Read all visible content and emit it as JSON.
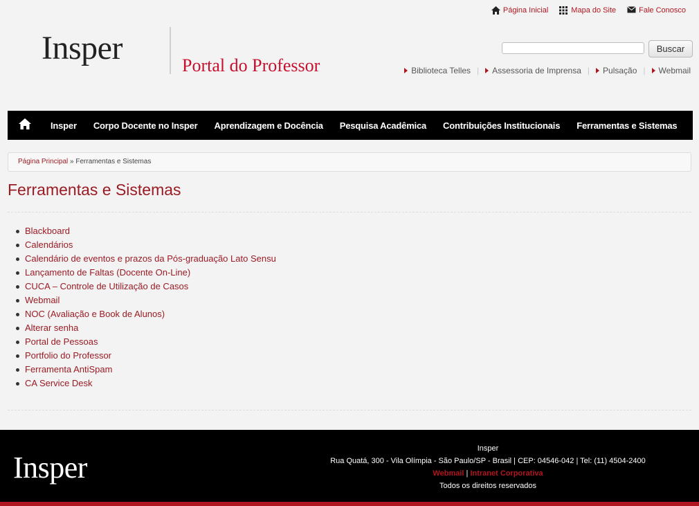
{
  "top_links": [
    {
      "label": "Página Inicial",
      "icon": "home-icon"
    },
    {
      "label": "Mapa do Site",
      "icon": "grid-icon"
    },
    {
      "label": "Fale Conosco",
      "icon": "envelope-icon"
    }
  ],
  "header": {
    "logo_text": "Insper",
    "portal_title": "Portal do Professor",
    "search": {
      "value": "",
      "button_label": "Buscar"
    },
    "quick_links": [
      "Biblioteca Telles",
      "Assessoria de Imprensa",
      "Pulsação",
      "Webmail"
    ]
  },
  "nav": {
    "home_icon": "home-icon",
    "items": [
      "Insper",
      "Corpo Docente no Insper",
      "Aprendizagem e Docência",
      "Pesquisa Acadêmica",
      "Contribuições Institucionais",
      "Ferramentas e Sistemas"
    ]
  },
  "breadcrumb": {
    "home": "Página Principal",
    "separator": "»",
    "current": "Ferramentas e Sistemas"
  },
  "main": {
    "title": "Ferramentas e Sistemas",
    "links": [
      "Blackboard",
      "Calendários",
      "Calendário de eventos e prazos da Pós-graduação Lato Sensu",
      "Lançamento de Faltas (Docente On-Line)",
      "CUCA – Controle de Utilização de Casos",
      "Webmail",
      "NOC (Avaliação e Book de Alunos)",
      "Alterar senha",
      "Portal de Pessoas",
      "Portfolio do Professor",
      "Ferramenta AntiSpam",
      "CA Service Desk"
    ]
  },
  "footer": {
    "logo_text": "Insper",
    "org_name": "Insper",
    "address": "Rua Quatá, 300 - Vila Olímpia - São Paulo/SP - Brasil | CEP: 04546-042 | Tel: (11) 4504-2400",
    "link_webmail": "Webmail",
    "link_separator": "|",
    "link_intranet": "Intranet Corporativa",
    "rights": "Todos os direitos reservados"
  },
  "colors": {
    "accent": "#c8102e",
    "link": "#9b1b24",
    "nav_bg": "#000000",
    "page_bg": "#f3f3f3"
  }
}
